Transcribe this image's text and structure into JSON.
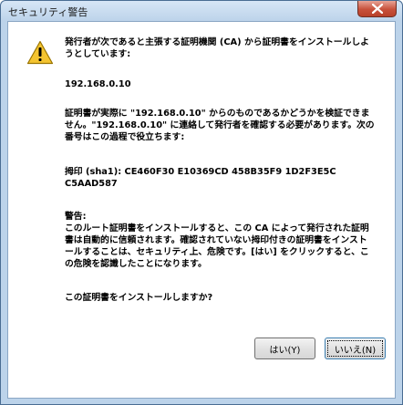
{
  "dialog": {
    "title": "セキュリティ警告"
  },
  "message": {
    "intro": "発行者が次であると主張する証明機関 (CA) から証明書をインストールしようとしています:",
    "ip": "192.168.0.10",
    "verify": "証明書が実際に \"192.168.0.10\" からのものであるかどうかを検証できません。\"192.168.0.10\" に連絡して発行者を確認する必要があります。次の番号はこの過程で役立ちます:",
    "thumbprint_label": "拇印 (sha1): CE460F30 E10369CD 458B35F9 1D2F3E5C C5AAD587",
    "warning_heading": "警告:",
    "warning_body": "このルート証明書をインストールすると、この CA によって発行された証明書は自動的に信頼されます。確認されていない拇印付きの証明書をインストールすることは、セキュリティ上、危険です。[はい] をクリックすると、この危険を認識したことになります。",
    "question": "この証明書をインストールしますか?"
  },
  "buttons": {
    "yes_label": "はい(Y)",
    "no_label": "いいえ(N)"
  },
  "colors": {
    "frame": "#bcd3ea",
    "close": "#c7503a",
    "warning_icon": "#f4c430"
  },
  "icons": {
    "close": "close-icon",
    "warning": "warning-icon"
  }
}
